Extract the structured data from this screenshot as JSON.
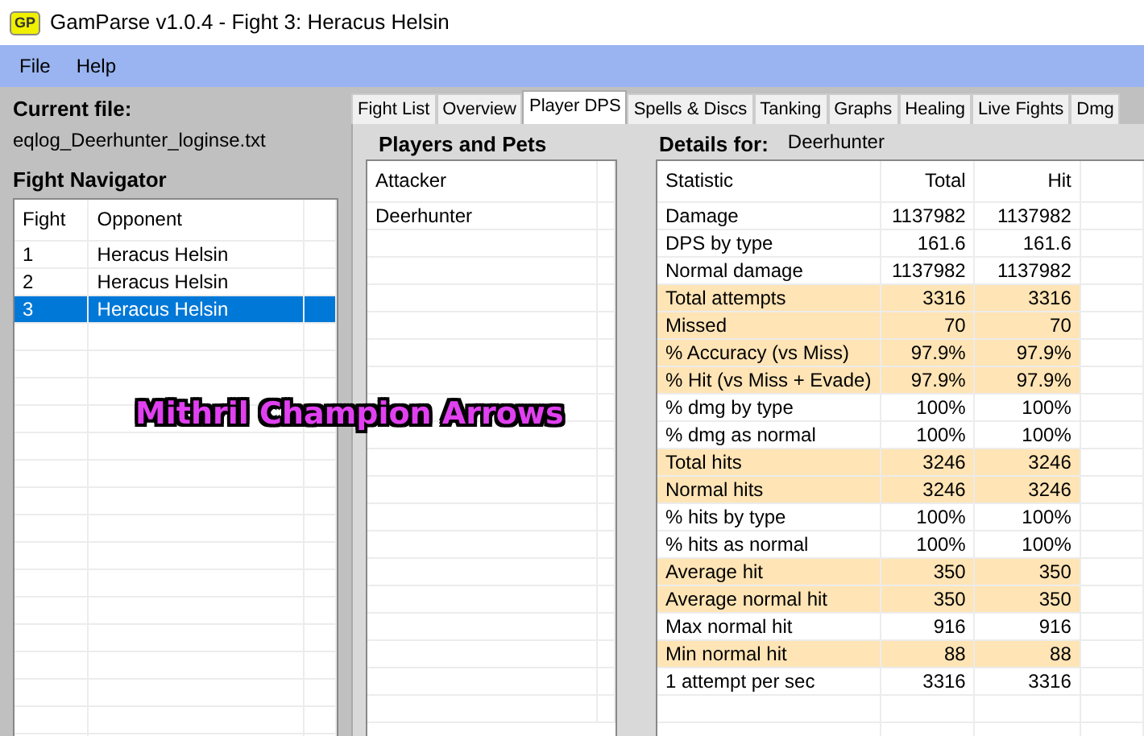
{
  "window": {
    "title": "GamParse v1.0.4 - Fight 3: Heracus Helsin",
    "app_icon_text": "GP"
  },
  "menu": [
    "File",
    "Help"
  ],
  "current_file": {
    "label": "Current file:",
    "value": "eqlog_Deerhunter_loginse.txt"
  },
  "fight_navigator": {
    "title": "Fight Navigator",
    "columns": [
      "Fight",
      "Opponent"
    ],
    "rows": [
      {
        "fight": "1",
        "opponent": "Heracus Helsin",
        "selected": false
      },
      {
        "fight": "2",
        "opponent": "Heracus Helsin",
        "selected": false
      },
      {
        "fight": "3",
        "opponent": "Heracus Helsin",
        "selected": true
      }
    ]
  },
  "tabs": [
    {
      "label": "Fight List",
      "selected": false
    },
    {
      "label": "Overview",
      "selected": false
    },
    {
      "label": "Player DPS",
      "selected": true
    },
    {
      "label": "Spells & Discs",
      "selected": false
    },
    {
      "label": "Tanking",
      "selected": false
    },
    {
      "label": "Graphs",
      "selected": false
    },
    {
      "label": "Healing",
      "selected": false
    },
    {
      "label": "Live Fights",
      "selected": false
    },
    {
      "label": "Dmg",
      "selected": false
    }
  ],
  "players_and_pets": {
    "title": "Players and Pets",
    "columns": [
      "Attacker"
    ],
    "rows": [
      "Deerhunter"
    ]
  },
  "details": {
    "label": "Details for:",
    "player": "Deerhunter",
    "columns": [
      "Statistic",
      "Total",
      "Hit"
    ],
    "rows": [
      {
        "statistic": "Damage",
        "total": "1137982",
        "hit": "1137982",
        "highlighted": false
      },
      {
        "statistic": "DPS by type",
        "total": "161.6",
        "hit": "161.6",
        "highlighted": false
      },
      {
        "statistic": "Normal damage",
        "total": "1137982",
        "hit": "1137982",
        "highlighted": false
      },
      {
        "statistic": "Total attempts",
        "total": "3316",
        "hit": "3316",
        "highlighted": true
      },
      {
        "statistic": "Missed",
        "total": "70",
        "hit": "70",
        "highlighted": true
      },
      {
        "statistic": "% Accuracy (vs Miss)",
        "total": "97.9%",
        "hit": "97.9%",
        "highlighted": true
      },
      {
        "statistic": "% Hit (vs Miss + Evade)",
        "total": "97.9%",
        "hit": "97.9%",
        "highlighted": true
      },
      {
        "statistic": "% dmg by type",
        "total": "100%",
        "hit": "100%",
        "highlighted": false
      },
      {
        "statistic": "% dmg as normal",
        "total": "100%",
        "hit": "100%",
        "highlighted": false
      },
      {
        "statistic": "Total hits",
        "total": "3246",
        "hit": "3246",
        "highlighted": true
      },
      {
        "statistic": "Normal hits",
        "total": "3246",
        "hit": "3246",
        "highlighted": true
      },
      {
        "statistic": "% hits by type",
        "total": "100%",
        "hit": "100%",
        "highlighted": false
      },
      {
        "statistic": "% hits as normal",
        "total": "100%",
        "hit": "100%",
        "highlighted": false
      },
      {
        "statistic": "Average hit",
        "total": "350",
        "hit": "350",
        "highlighted": true
      },
      {
        "statistic": "Average normal hit",
        "total": "350",
        "hit": "350",
        "highlighted": true
      },
      {
        "statistic": "Max normal hit",
        "total": "916",
        "hit": "916",
        "highlighted": false
      },
      {
        "statistic": "Min normal hit",
        "total": "88",
        "hit": "88",
        "highlighted": true
      },
      {
        "statistic": "1 attempt per sec",
        "total": "3316",
        "hit": "3316",
        "highlighted": false
      }
    ]
  },
  "overlay_caption": "Mithril Champion Arrows"
}
